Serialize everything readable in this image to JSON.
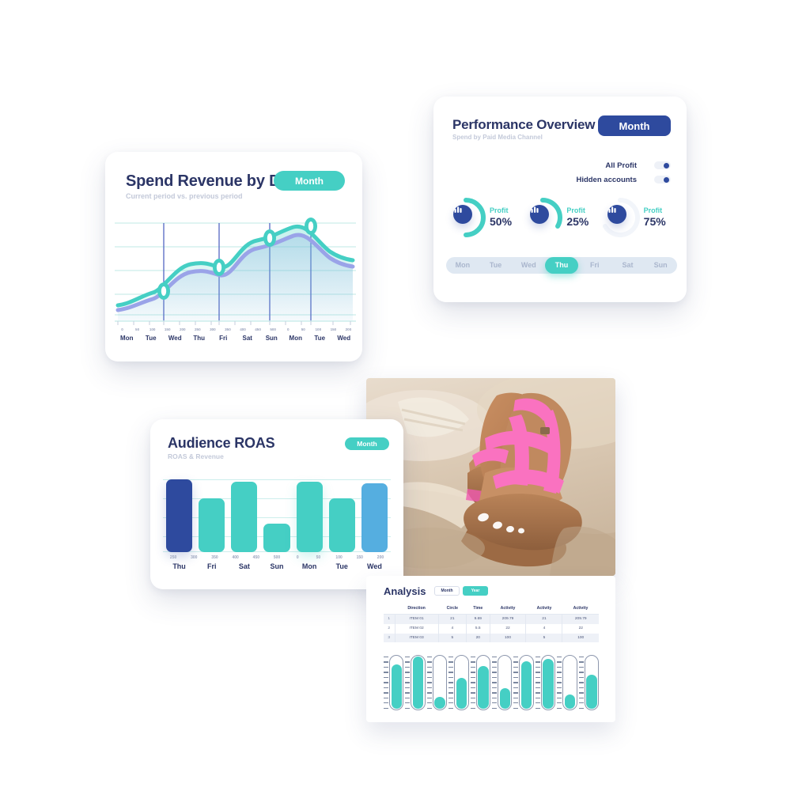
{
  "background": {
    "line_color": "#ffffff",
    "node_color": "#ffffff"
  },
  "colors": {
    "teal": "#45cfc4",
    "navy": "#2e4a9e",
    "dark_text": "#2b3566",
    "muted": "#c3c9d9",
    "light_blue": "#55aee0",
    "periwinkle": "#9aa3e8"
  },
  "spend_card": {
    "title": "Spend Revenue by Day",
    "subtitle": "Current period vs. previous period",
    "button_label": "Month",
    "chart_data": {
      "type": "area",
      "title": "Spend Revenue by Day",
      "xlabel": "",
      "ylabel": "",
      "grid": true,
      "legend_position": "none",
      "tick_labels": [
        "0",
        "50",
        "100",
        "150",
        "200",
        "250",
        "300",
        "350",
        "400",
        "450",
        "500",
        "0",
        "50",
        "100",
        "150",
        "200"
      ],
      "categories": [
        "Mon",
        "Tue",
        "Wed",
        "Thu",
        "Fri",
        "Sat",
        "Sun",
        "Mon",
        "Tue",
        "Wed"
      ],
      "series": [
        {
          "name": "Current period",
          "color": "#45cfc4",
          "values": [
            12,
            20,
            40,
            46,
            42,
            58,
            72,
            80,
            92,
            70
          ]
        },
        {
          "name": "Previous period",
          "color": "#9aa3e8",
          "values": [
            8,
            15,
            35,
            42,
            38,
            53,
            68,
            76,
            87,
            65
          ]
        }
      ],
      "markers_at": [
        "Tue",
        "Fri",
        "Sun",
        "Tue"
      ],
      "ylim": [
        0,
        110
      ]
    }
  },
  "performance_card": {
    "title": "Performance Overview",
    "subtitle": "Spend by Paid Media Channel",
    "button_label": "Month",
    "toggles": [
      {
        "label": "All Profit",
        "on": true
      },
      {
        "label": "Hidden accounts",
        "on": true
      }
    ],
    "gauges": [
      {
        "label": "Profit",
        "value": "50%",
        "percent": 50,
        "icon": "bar-chart-icon"
      },
      {
        "label": "Profit",
        "value": "25%",
        "percent": 25,
        "icon": "bar-chart-icon"
      },
      {
        "label": "Profit",
        "value": "75%",
        "percent": 75,
        "icon": "bar-chart-icon"
      }
    ],
    "days": [
      {
        "label": "Mon",
        "selected": false
      },
      {
        "label": "Tue",
        "selected": false
      },
      {
        "label": "Wed",
        "selected": false
      },
      {
        "label": "Thu",
        "selected": true
      },
      {
        "label": "Fri",
        "selected": false
      },
      {
        "label": "Sat",
        "selected": false
      },
      {
        "label": "Sun",
        "selected": false
      }
    ]
  },
  "roas_card": {
    "title": "Audience ROAS",
    "subtitle": "ROAS & Revenue",
    "button_label": "Month",
    "chart_data": {
      "type": "bar",
      "title": "Audience ROAS",
      "xlabel": "",
      "ylabel": "",
      "grid": true,
      "legend_position": "none",
      "tick_labels": [
        "250",
        "300",
        "350",
        "400",
        "450",
        "500",
        "0",
        "50",
        "100",
        "150",
        "200"
      ],
      "categories": [
        "Thu",
        "Fri",
        "Sat",
        "Sun",
        "Mon",
        "Tue",
        "Wed"
      ],
      "values": [
        100,
        74,
        97,
        40,
        97,
        74,
        95
      ],
      "bar_colors": [
        "#2e4a9e",
        "#45cfc4",
        "#45cfc4",
        "#45cfc4",
        "#45cfc4",
        "#45cfc4",
        "#55aee0"
      ],
      "ylim": [
        0,
        105
      ]
    }
  },
  "photo": {
    "alt": "Pink strappy platform sandals on sand",
    "name": "product-photo"
  },
  "analysis_card": {
    "title": "Analysis",
    "segmented": [
      {
        "label": "Month",
        "selected": false
      },
      {
        "label": "Year",
        "selected": true
      }
    ],
    "table": {
      "columns": [
        "",
        "Direction",
        "Circle",
        "Time",
        "Activity",
        "Activity",
        "Activity"
      ],
      "rows": [
        [
          "1",
          "ITEM 01",
          "21",
          "9.69",
          "209.79",
          "21",
          "209.79"
        ],
        [
          "2",
          "ITEM 02",
          "4",
          "5.5",
          "22",
          "4",
          "22"
        ],
        [
          "3",
          "ITEM 03",
          "5",
          "20",
          "100",
          "5",
          "100"
        ]
      ]
    },
    "chart_data": {
      "type": "bar",
      "title": "",
      "orientation": "vertical-gauge",
      "categories": [
        "g1",
        "g2",
        "g3",
        "g4",
        "g5",
        "g6",
        "g7",
        "g8",
        "g9",
        "g10"
      ],
      "values": [
        82,
        96,
        22,
        56,
        78,
        38,
        88,
        92,
        26,
        62
      ],
      "color": "#45cfc4",
      "ylim": [
        0,
        100
      ]
    }
  }
}
